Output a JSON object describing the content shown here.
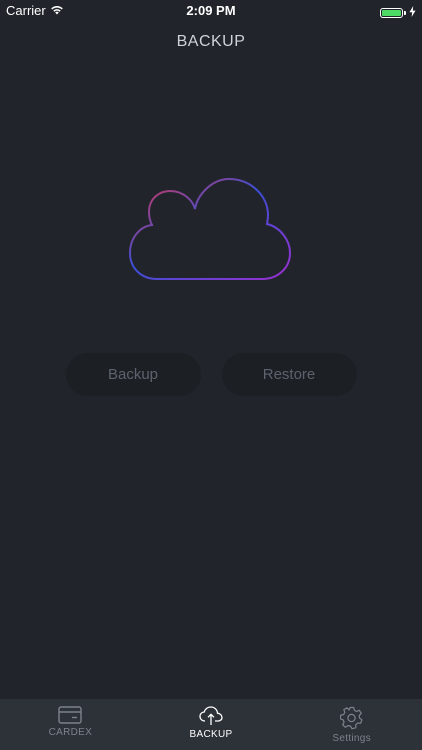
{
  "status_bar": {
    "carrier": "Carrier",
    "time": "2:09 PM",
    "wifi_icon": "wifi-icon",
    "battery_level": 1.0,
    "battery_color": "#4cd964"
  },
  "header": {
    "title": "BACKUP"
  },
  "hero": {
    "icon": "cloud-icon",
    "gradient_colors": [
      "#e0364a",
      "#3b4fd6",
      "#9b2fd0"
    ]
  },
  "actions": {
    "backup_label": "Backup",
    "restore_label": "Restore"
  },
  "tab_bar": {
    "tabs": [
      {
        "label": "CARDEX",
        "icon": "card-icon",
        "active": false
      },
      {
        "label": "BACKUP",
        "icon": "cloud-upload-icon",
        "active": true
      },
      {
        "label": "Settings",
        "icon": "gear-icon",
        "active": false
      }
    ]
  },
  "colors": {
    "background": "#21252b",
    "tab_bar": "#2d3138",
    "button_bg": "#1c1f24"
  }
}
